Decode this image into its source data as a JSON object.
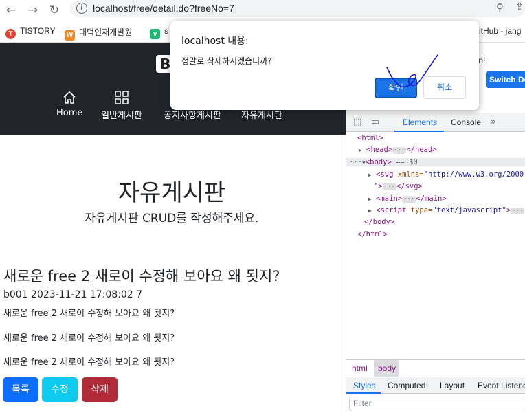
{
  "browser": {
    "url": "localhost/free/detail.do?freeNo=7",
    "bookmarks": [
      {
        "label": "TISTORY",
        "color": "#e8402e",
        "glyph": "T"
      },
      {
        "label": "대덕인재개발원",
        "color": "#f08a24",
        "glyph": "W"
      },
      {
        "label": "s",
        "color": "#22b573",
        "glyph": "v"
      }
    ],
    "bookmark_right": "itHub - jang"
  },
  "site": {
    "brand": "B",
    "nav": [
      {
        "label": "Home",
        "icon": "home-icon"
      },
      {
        "label": "일반게시판",
        "icon": "grid-icon"
      },
      {
        "label": "공지사항게시판",
        "icon": "notice-icon"
      },
      {
        "label": "자유게시판",
        "icon": "free-board-icon"
      }
    ],
    "hero_title": "자유게시판",
    "hero_subtitle": "자유게시판 CRUD를 작성해주세요.",
    "post": {
      "title": "새로운 free 2 새로이 수정해 보아요 왜 됫지?",
      "meta": "b001 2023-11-21 17:08:02 7",
      "lines": [
        "새로운 free 2 새로이 수정해 보아요 왜 됫지?",
        "새로운 free 2 새로이 수정해 보아요 왜 됫지?",
        "새로운 free 2 새로이 수정해 보아요 왜 됫지?"
      ]
    },
    "buttons": {
      "list": "목록",
      "edit": "수정",
      "delete": "삭제"
    }
  },
  "dialog": {
    "title": "localhost 내용:",
    "message": "정말로 삭제하시겠습니까?",
    "ok": "확인",
    "cancel": "취소"
  },
  "devtools": {
    "top_text": "rean!",
    "switch_label": "Switch De",
    "tabs": [
      "Elements",
      "Console"
    ],
    "dom": {
      "html_open": "<html>",
      "head": "<head>",
      "head_close": "</head>",
      "body": "<body>",
      "body_marker": "== $0",
      "svg_attr": "xmlns=",
      "svg_val": "\"http://www.w3.org/2000",
      "svg_close": "</svg>",
      "main": "<main>",
      "main_close": "</main>",
      "script_attr": "type=",
      "script_val": "\"text/javascript\"",
      "body_close": "</body>",
      "html_close": "</html>"
    },
    "crumbs": [
      "html",
      "body"
    ],
    "subtabs": [
      "Styles",
      "Computed",
      "Layout",
      "Event Listene"
    ],
    "filter_placeholder": "Filter"
  }
}
